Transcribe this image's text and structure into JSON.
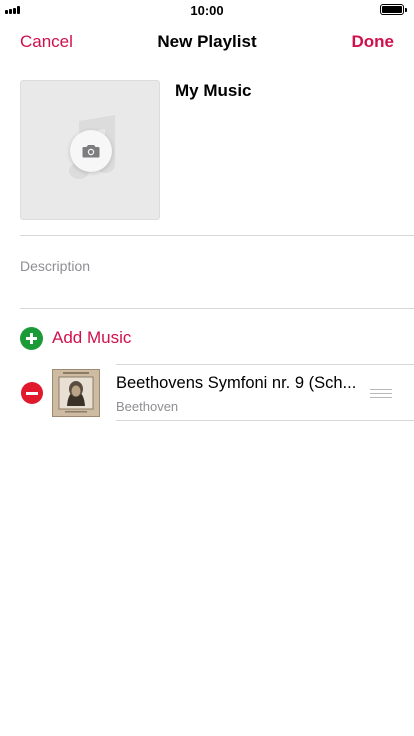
{
  "status_bar": {
    "time": "10:00"
  },
  "nav": {
    "cancel": "Cancel",
    "title": "New Playlist",
    "done": "Done"
  },
  "playlist": {
    "name": "My Music",
    "description_placeholder": "Description"
  },
  "actions": {
    "add_music": "Add Music"
  },
  "tracks": [
    {
      "title": "Beethovens Symfoni nr. 9 (Sch...",
      "artist": "Beethoven"
    }
  ],
  "icons": {
    "camera": "camera-icon",
    "add": "plus-circle-icon",
    "remove": "minus-circle-icon",
    "reorder": "reorder-handle-icon"
  },
  "colors": {
    "accent": "#d0104c",
    "add_green": "#1a9b38",
    "remove_red": "#e0192d"
  }
}
